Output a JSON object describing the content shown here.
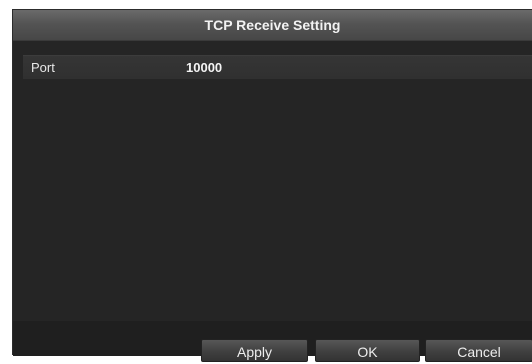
{
  "dialog": {
    "title": "TCP Receive Setting",
    "fields": [
      {
        "label": "Port",
        "value": "10000"
      }
    ],
    "buttons": {
      "apply": "Apply",
      "ok": "OK",
      "cancel": "Cancel"
    }
  }
}
